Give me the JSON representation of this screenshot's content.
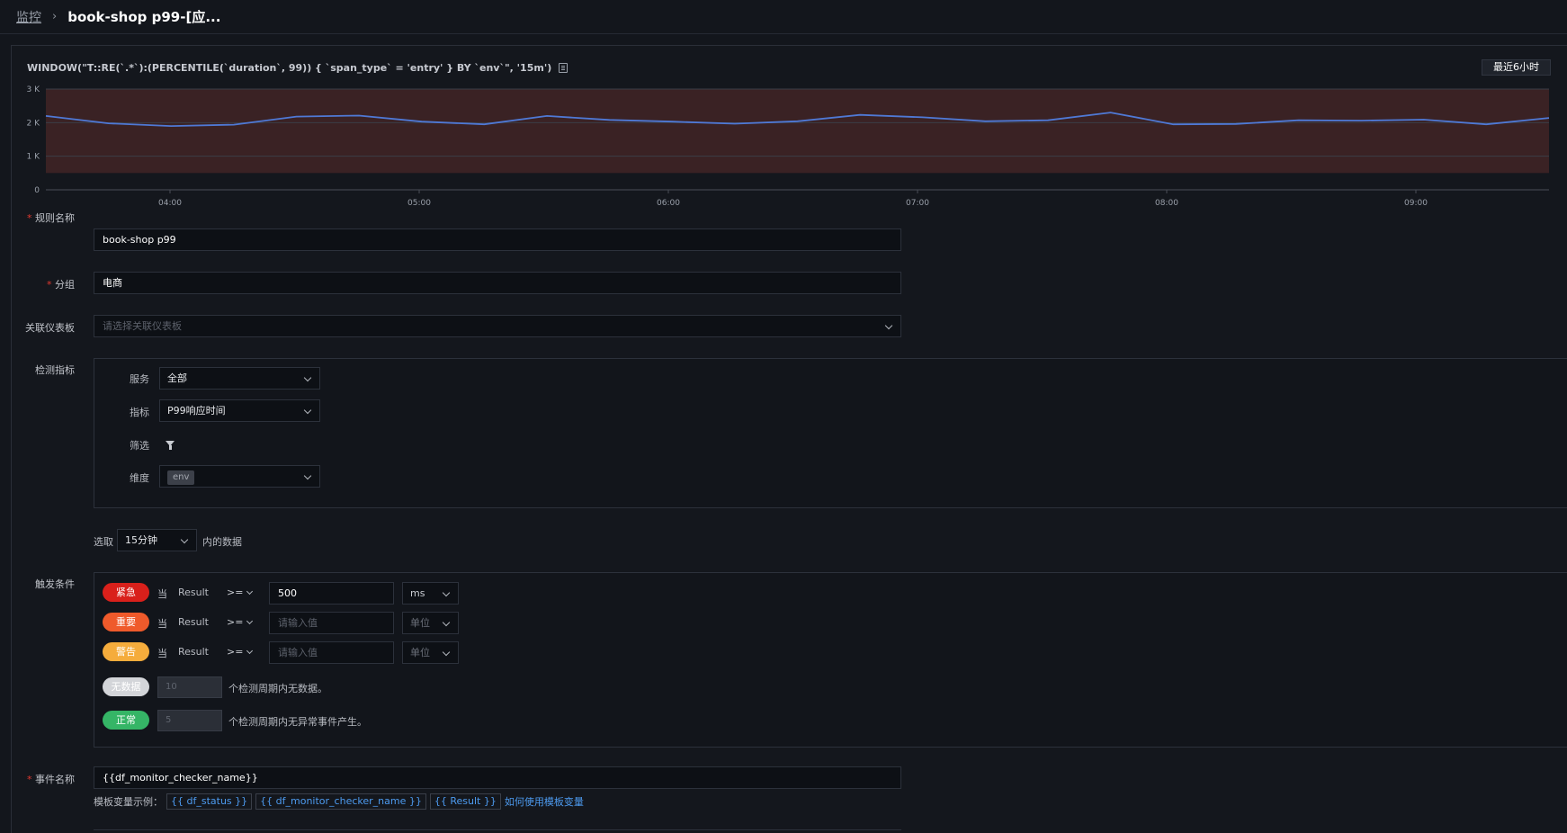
{
  "breadcrumb": {
    "root": "监控",
    "current": "book-shop p99-[应..."
  },
  "query": {
    "text": "WINDOW(\"T::RE(`.*`):(PERCENTILE(`duration`, 99)) { `span_type` = 'entry' } BY `env`\", '15m')",
    "copy_icon": "copy-icon"
  },
  "time_range": "最近6小时",
  "chart_data": {
    "type": "line",
    "y_ticks": [
      "3 K",
      "2 K",
      "1 K",
      "0"
    ],
    "x_ticks": [
      "04:00",
      "05:00",
      "06:00",
      "07:00",
      "08:00",
      "09:00"
    ],
    "ylim": [
      0,
      3000
    ],
    "threshold_band": [
      500,
      3000
    ],
    "series": [
      {
        "values": [
          2200,
          1980,
          1900,
          1940,
          2180,
          2210,
          2030,
          1950,
          2200,
          2080,
          2030,
          1970,
          2040,
          2230,
          2160,
          2040,
          2070,
          2300,
          1950,
          1960,
          2070,
          2060,
          2090,
          1950,
          2140
        ]
      }
    ],
    "colors": {
      "line": "#4f79d6",
      "band": "#3a2224",
      "grid": "#3a3e46"
    }
  },
  "form": {
    "rule_name": {
      "label": "规则名称",
      "value": "book-shop p99"
    },
    "group": {
      "label": "分组",
      "value": "电商"
    },
    "dashboard": {
      "label": "关联仪表板",
      "placeholder": "请选择关联仪表板"
    },
    "metric": {
      "label": "检测指标",
      "service": {
        "label": "服务",
        "value": "全部"
      },
      "indicator": {
        "label": "指标",
        "value": "P99响应时间"
      },
      "filter": {
        "label": "筛选",
        "icon": "filter-icon"
      },
      "dimension": {
        "label": "维度",
        "tag": "env"
      }
    },
    "window": {
      "prefix": "选取",
      "value": "15分钟",
      "suffix": "内的数据"
    },
    "trigger": {
      "label": "触发条件",
      "levels": [
        {
          "name": "紧急",
          "color": "#d9201b",
          "when": "当",
          "field": "Result",
          "op": ">=",
          "value": "500",
          "placeholder": "请输入值",
          "unit": "ms"
        },
        {
          "name": "重要",
          "color": "#ef5a2b",
          "when": "当",
          "field": "Result",
          "op": ">=",
          "value": "",
          "placeholder": "请输入值",
          "unit": "单位"
        },
        {
          "name": "警告",
          "color": "#f5ac3c",
          "when": "当",
          "field": "Result",
          "op": ">=",
          "value": "",
          "placeholder": "请输入值",
          "unit": "单位"
        }
      ],
      "nodata": {
        "name": "无数据",
        "color": "#d3d5d9",
        "value": "10",
        "text": "个检测周期内无数据。"
      },
      "normal": {
        "name": "正常",
        "color": "#35b566",
        "value": "5",
        "text": "个检测周期内无异常事件产生。"
      }
    },
    "event_name": {
      "label": "事件名称",
      "value": "{{df_monitor_checker_name}}",
      "examples_label": "模板变量示例：",
      "examples": [
        "{{ df_status }}",
        "{{ df_monitor_checker_name }}",
        "{{ Result }}"
      ],
      "help_link": "如何使用模板变量"
    }
  }
}
